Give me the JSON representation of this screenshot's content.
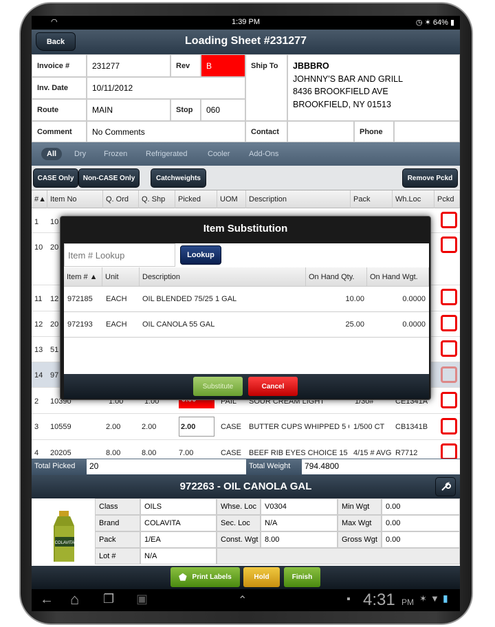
{
  "status": {
    "time": "1:39 PM",
    "battery": "64%"
  },
  "header": {
    "back_label": "Back",
    "title": "Loading Sheet #231277"
  },
  "invoice": {
    "invoice_label": "Invoice #",
    "invoice_value": "231277",
    "rev_label": "Rev",
    "rev_value": "B",
    "date_label": "Inv. Date",
    "date_value": "10/11/2012",
    "route_label": "Route",
    "route_value": "MAIN",
    "stop_label": "Stop",
    "stop_value": "060",
    "comment_label": "Comment",
    "comment_value": "No Comments",
    "shipto_label": "Ship To",
    "shipto_lines": [
      "JBBBRO",
      "JOHNNY'S BAR AND GRILL",
      "8436 BROOKFIELD AVE",
      "BROOKFIELD, NY 01513"
    ],
    "contact_label": "Contact",
    "phone_label": "Phone"
  },
  "tabs": [
    "All",
    "Dry",
    "Frozen",
    "Refrigerated",
    "Cooler",
    "Add-Ons"
  ],
  "filters": {
    "case_only": "CASE Only",
    "non_case_only": "Non-CASE Only",
    "catchweights": "Catchweights",
    "remove_pckd": "Remove Pckd"
  },
  "table": {
    "headers": [
      "#▲",
      "Item No",
      "Q. Ord",
      "Q. Shp",
      "Picked",
      "UOM",
      "Description",
      "Pack",
      "Wh.Loc",
      "Pckd"
    ],
    "rows": [
      {
        "num": "1",
        "item": "10"
      },
      {
        "num": "10",
        "item": "20"
      },
      {
        "num": "11",
        "item": "12"
      },
      {
        "num": "12",
        "item": "20"
      },
      {
        "num": "13",
        "item": "51"
      },
      {
        "num": "14",
        "item": "97"
      },
      {
        "num": "2",
        "item": "10390",
        "qord": "1.00",
        "qshp": "1.00",
        "picked": "0.00",
        "uom": "PAIL",
        "desc": "SOUR CREAM LIGHT",
        "pack": "1/30#",
        "loc": "CE1341A"
      },
      {
        "num": "3",
        "item": "10559",
        "qord": "2.00",
        "qshp": "2.00",
        "picked": "2.00",
        "uom": "CASE",
        "desc": "BUTTER CUPS WHIPPED 5 C",
        "pack": "1/500 CT",
        "loc": "CB1341B"
      },
      {
        "num": "4",
        "item": "20205",
        "qord": "8.00",
        "qshp": "8.00",
        "picked": "7.00",
        "uom": "CASE",
        "desc": "BEEF RIB EYES CHOICE 15 ±",
        "pack": "4/15 # AVG",
        "loc": "R7712"
      }
    ]
  },
  "modal": {
    "title": "Item Substitution",
    "lookup_placeholder": "Item # Lookup",
    "lookup_button": "Lookup",
    "headers": [
      "Item # ▲",
      "Unit",
      "Description",
      "On Hand Qty.",
      "On Hand Wgt."
    ],
    "rows": [
      {
        "item": "972185",
        "unit": "EACH",
        "desc": "OIL BLENDED 75/25 1 GAL",
        "qty": "10.00",
        "wgt": "0.0000"
      },
      {
        "item": "972193",
        "unit": "EACH",
        "desc": "OIL CANOLA 55 GAL",
        "qty": "25.00",
        "wgt": "0.0000"
      }
    ],
    "substitute_button": "Substitute",
    "cancel_button": "Cancel"
  },
  "totals": {
    "picked_label": "Total Picked",
    "picked_value": "20",
    "weight_label": "Total Weight",
    "weight_value": "794.4800"
  },
  "detail": {
    "title": "972263 - OIL CANOLA GAL",
    "image_label": "COLAVITA",
    "class_label": "Class",
    "class_value": "OILS",
    "whse_label": "Whse. Loc",
    "whse_value": "V0304",
    "minwgt_label": "Min Wgt",
    "minwgt_value": "0.00",
    "brand_label": "Brand",
    "brand_value": "COLAVITA",
    "secloc_label": "Sec. Loc",
    "secloc_value": "N/A",
    "maxwgt_label": "Max Wgt",
    "maxwgt_value": "0.00",
    "pack_label": "Pack",
    "pack_value": "1/EA",
    "const_label": "Const. Wgt",
    "const_value": "8.00",
    "gross_label": "Gross Wgt",
    "gross_value": "0.00",
    "lot_label": "Lot #",
    "lot_value": "N/A"
  },
  "actions": {
    "print_labels": "Print Labels",
    "hold": "Hold",
    "finish": "Finish"
  },
  "navbar": {
    "time": "4:31",
    "ampm": "PM"
  },
  "colors": {
    "red": "#ff0000",
    "green": "#6aa030",
    "yellow": "#e8b820",
    "navy": "#0a2050"
  }
}
